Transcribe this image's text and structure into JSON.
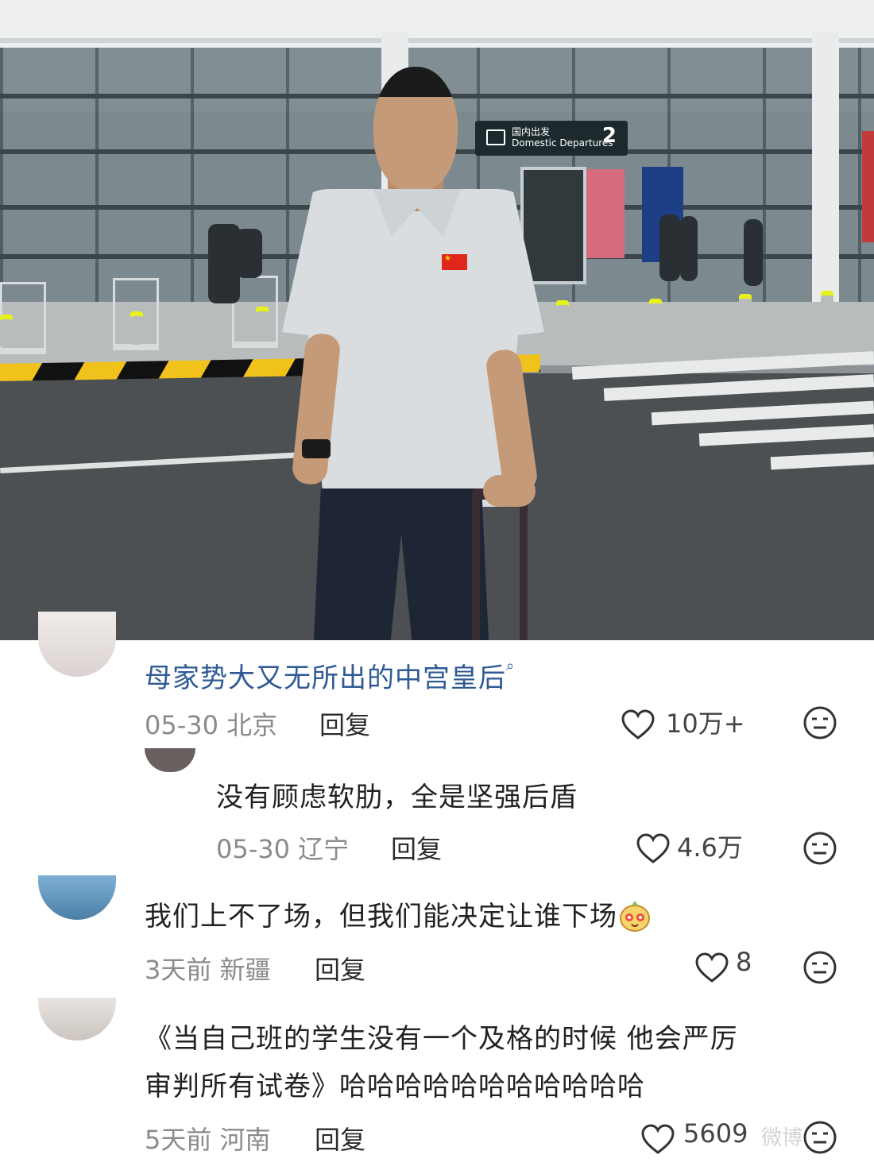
{
  "comments": [
    {
      "username": "母家势大又无所出的中宫皇后",
      "date": "05-30",
      "location": "北京",
      "reply": "回复",
      "likes": "10万+"
    },
    {
      "text": "没有顾虑软肋，全是坚强后盾",
      "date": "05-30",
      "location": "辽宁",
      "reply": "回复",
      "likes": "4.6万"
    },
    {
      "text": "我们上不了场，但我们能决定让谁下场",
      "date": "3天前",
      "location": "新疆",
      "reply": "回复",
      "likes": "8"
    },
    {
      "text_line1": "《当自己班的学生没有一个及格的时候 他会严厉",
      "text_line2": "审判所有试卷》哈哈哈哈哈哈哈哈哈哈哈",
      "date": "5天前",
      "location": "河南",
      "reply": "回复",
      "likes": "5609"
    }
  ],
  "watermark": "微博"
}
